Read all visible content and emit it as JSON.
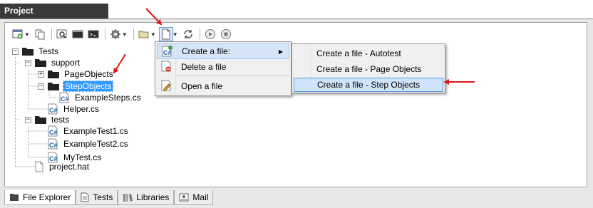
{
  "window": {
    "title": "Project"
  },
  "toolbar": {
    "buttons": [
      {
        "name": "new-project-icon"
      },
      {
        "name": "copy-icon"
      },
      {
        "name": "preview-icon"
      },
      {
        "name": "console-icon"
      },
      {
        "name": "command-icon"
      },
      {
        "name": "settings-icon"
      },
      {
        "name": "open-folder-icon"
      },
      {
        "name": "new-file-icon"
      },
      {
        "name": "refresh-icon"
      },
      {
        "name": "run-icon"
      },
      {
        "name": "stop-icon"
      }
    ]
  },
  "tree": {
    "nodes": [
      {
        "label": "Tests"
      },
      {
        "label": "support"
      },
      {
        "label": "PageObjects"
      },
      {
        "label": "StepObjects"
      },
      {
        "label": "ExampleSteps.cs"
      },
      {
        "label": "Helper.cs"
      },
      {
        "label": "tests"
      },
      {
        "label": "ExampleTest1.cs"
      },
      {
        "label": "ExampleTest2.cs"
      },
      {
        "label": "MyTest.cs"
      },
      {
        "label": "project.hat"
      }
    ]
  },
  "context_menu": {
    "items": [
      {
        "label": "Create a file:"
      },
      {
        "label": "Delete a file"
      },
      {
        "label": "Open a file"
      }
    ]
  },
  "submenu": {
    "items": [
      {
        "label": "Create a file - Autotest"
      },
      {
        "label": "Create a file - Page Objects"
      },
      {
        "label": "Create a file - Step Objects"
      }
    ]
  },
  "bottom_tabs": [
    {
      "label": "File Explorer"
    },
    {
      "label": "Tests"
    },
    {
      "label": "Libraries"
    },
    {
      "label": "Mail"
    }
  ],
  "colors": {
    "selection": "#3399ff",
    "annotation_arrow": "#e0161a",
    "title_bar": "#3a3a3a"
  }
}
